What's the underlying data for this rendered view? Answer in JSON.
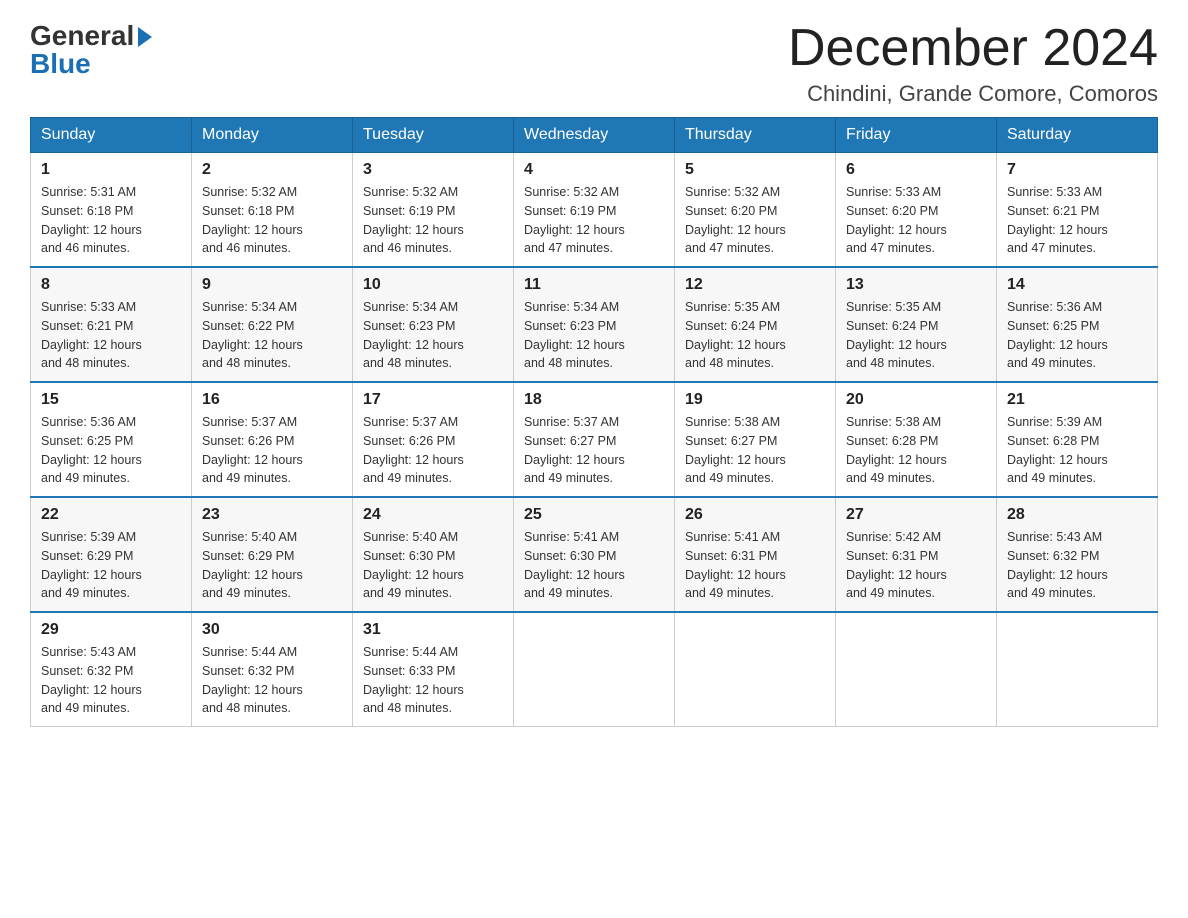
{
  "header": {
    "logo_general": "General",
    "logo_blue": "Blue",
    "month_year": "December 2024",
    "location": "Chindini, Grande Comore, Comoros"
  },
  "weekdays": [
    "Sunday",
    "Monday",
    "Tuesday",
    "Wednesday",
    "Thursday",
    "Friday",
    "Saturday"
  ],
  "weeks": [
    [
      {
        "day": 1,
        "sunrise": "5:31 AM",
        "sunset": "6:18 PM",
        "daylight": "12 hours and 46 minutes."
      },
      {
        "day": 2,
        "sunrise": "5:32 AM",
        "sunset": "6:18 PM",
        "daylight": "12 hours and 46 minutes."
      },
      {
        "day": 3,
        "sunrise": "5:32 AM",
        "sunset": "6:19 PM",
        "daylight": "12 hours and 46 minutes."
      },
      {
        "day": 4,
        "sunrise": "5:32 AM",
        "sunset": "6:19 PM",
        "daylight": "12 hours and 47 minutes."
      },
      {
        "day": 5,
        "sunrise": "5:32 AM",
        "sunset": "6:20 PM",
        "daylight": "12 hours and 47 minutes."
      },
      {
        "day": 6,
        "sunrise": "5:33 AM",
        "sunset": "6:20 PM",
        "daylight": "12 hours and 47 minutes."
      },
      {
        "day": 7,
        "sunrise": "5:33 AM",
        "sunset": "6:21 PM",
        "daylight": "12 hours and 47 minutes."
      }
    ],
    [
      {
        "day": 8,
        "sunrise": "5:33 AM",
        "sunset": "6:21 PM",
        "daylight": "12 hours and 48 minutes."
      },
      {
        "day": 9,
        "sunrise": "5:34 AM",
        "sunset": "6:22 PM",
        "daylight": "12 hours and 48 minutes."
      },
      {
        "day": 10,
        "sunrise": "5:34 AM",
        "sunset": "6:23 PM",
        "daylight": "12 hours and 48 minutes."
      },
      {
        "day": 11,
        "sunrise": "5:34 AM",
        "sunset": "6:23 PM",
        "daylight": "12 hours and 48 minutes."
      },
      {
        "day": 12,
        "sunrise": "5:35 AM",
        "sunset": "6:24 PM",
        "daylight": "12 hours and 48 minutes."
      },
      {
        "day": 13,
        "sunrise": "5:35 AM",
        "sunset": "6:24 PM",
        "daylight": "12 hours and 48 minutes."
      },
      {
        "day": 14,
        "sunrise": "5:36 AM",
        "sunset": "6:25 PM",
        "daylight": "12 hours and 49 minutes."
      }
    ],
    [
      {
        "day": 15,
        "sunrise": "5:36 AM",
        "sunset": "6:25 PM",
        "daylight": "12 hours and 49 minutes."
      },
      {
        "day": 16,
        "sunrise": "5:37 AM",
        "sunset": "6:26 PM",
        "daylight": "12 hours and 49 minutes."
      },
      {
        "day": 17,
        "sunrise": "5:37 AM",
        "sunset": "6:26 PM",
        "daylight": "12 hours and 49 minutes."
      },
      {
        "day": 18,
        "sunrise": "5:37 AM",
        "sunset": "6:27 PM",
        "daylight": "12 hours and 49 minutes."
      },
      {
        "day": 19,
        "sunrise": "5:38 AM",
        "sunset": "6:27 PM",
        "daylight": "12 hours and 49 minutes."
      },
      {
        "day": 20,
        "sunrise": "5:38 AM",
        "sunset": "6:28 PM",
        "daylight": "12 hours and 49 minutes."
      },
      {
        "day": 21,
        "sunrise": "5:39 AM",
        "sunset": "6:28 PM",
        "daylight": "12 hours and 49 minutes."
      }
    ],
    [
      {
        "day": 22,
        "sunrise": "5:39 AM",
        "sunset": "6:29 PM",
        "daylight": "12 hours and 49 minutes."
      },
      {
        "day": 23,
        "sunrise": "5:40 AM",
        "sunset": "6:29 PM",
        "daylight": "12 hours and 49 minutes."
      },
      {
        "day": 24,
        "sunrise": "5:40 AM",
        "sunset": "6:30 PM",
        "daylight": "12 hours and 49 minutes."
      },
      {
        "day": 25,
        "sunrise": "5:41 AM",
        "sunset": "6:30 PM",
        "daylight": "12 hours and 49 minutes."
      },
      {
        "day": 26,
        "sunrise": "5:41 AM",
        "sunset": "6:31 PM",
        "daylight": "12 hours and 49 minutes."
      },
      {
        "day": 27,
        "sunrise": "5:42 AM",
        "sunset": "6:31 PM",
        "daylight": "12 hours and 49 minutes."
      },
      {
        "day": 28,
        "sunrise": "5:43 AM",
        "sunset": "6:32 PM",
        "daylight": "12 hours and 49 minutes."
      }
    ],
    [
      {
        "day": 29,
        "sunrise": "5:43 AM",
        "sunset": "6:32 PM",
        "daylight": "12 hours and 49 minutes."
      },
      {
        "day": 30,
        "sunrise": "5:44 AM",
        "sunset": "6:32 PM",
        "daylight": "12 hours and 48 minutes."
      },
      {
        "day": 31,
        "sunrise": "5:44 AM",
        "sunset": "6:33 PM",
        "daylight": "12 hours and 48 minutes."
      },
      null,
      null,
      null,
      null
    ]
  ],
  "labels": {
    "sunrise": "Sunrise:",
    "sunset": "Sunset:",
    "daylight": "Daylight:"
  }
}
